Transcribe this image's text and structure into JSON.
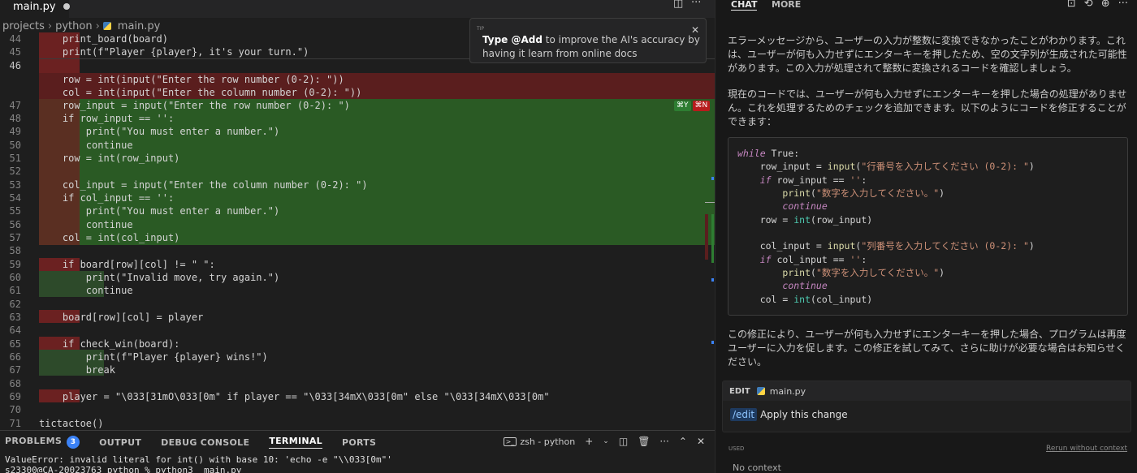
{
  "tabbar": {
    "active_tab": "main.py"
  },
  "breadcrumb": {
    "items": [
      "projects",
      "python",
      "main.py"
    ]
  },
  "editor": {
    "lines": [
      {
        "n": "44",
        "text": "    print_board(board)"
      },
      {
        "n": "45",
        "text": "    print(f\"Player {player}, it's your turn.\")"
      },
      {
        "n": "46",
        "text": ""
      },
      {
        "n": "",
        "text": "    row = int(input(\"Enter the row number (0-2): \"))"
      },
      {
        "n": "",
        "text": "    col = int(input(\"Enter the column number (0-2): \"))"
      },
      {
        "n": "47",
        "text": "    row_input = input(\"Enter the row number (0-2): \")"
      },
      {
        "n": "48",
        "text": "    if row_input == '':"
      },
      {
        "n": "49",
        "text": "        print(\"You must enter a number.\")"
      },
      {
        "n": "50",
        "text": "        continue"
      },
      {
        "n": "51",
        "text": "    row = int(row_input)"
      },
      {
        "n": "52",
        "text": ""
      },
      {
        "n": "53",
        "text": "    col_input = input(\"Enter the column number (0-2): \")"
      },
      {
        "n": "54",
        "text": "    if col_input == '':"
      },
      {
        "n": "55",
        "text": "        print(\"You must enter a number.\")"
      },
      {
        "n": "56",
        "text": "        continue"
      },
      {
        "n": "57",
        "text": "    col = int(col_input)"
      },
      {
        "n": "58",
        "text": ""
      },
      {
        "n": "59",
        "text": "    if board[row][col] != \" \":"
      },
      {
        "n": "60",
        "text": "        print(\"Invalid move, try again.\")"
      },
      {
        "n": "61",
        "text": "        continue"
      },
      {
        "n": "62",
        "text": ""
      },
      {
        "n": "63",
        "text": "    board[row][col] = player"
      },
      {
        "n": "64",
        "text": ""
      },
      {
        "n": "65",
        "text": "    if check_win(board):"
      },
      {
        "n": "66",
        "text": "        print(f\"Player {player} wins!\")"
      },
      {
        "n": "67",
        "text": "        break"
      },
      {
        "n": "68",
        "text": ""
      },
      {
        "n": "69",
        "text": "    player = \"\\033[31mO\\033[0m\" if player == \"\\033[34mX\\033[0m\" else \"\\033[34mX\\033[0m\""
      },
      {
        "n": "70",
        "text": ""
      },
      {
        "n": "71",
        "text": "tictactoe()"
      }
    ],
    "accept_hint": "⌘Y",
    "reject_hint": "⌘N"
  },
  "tip": {
    "label": "TIP",
    "bold": "Type @Add",
    "text": " to improve the AI's accuracy by having it learn from online docs"
  },
  "panel": {
    "tabs": [
      "PROBLEMS",
      "OUTPUT",
      "DEBUG CONSOLE",
      "TERMINAL",
      "PORTS"
    ],
    "problems_count": "3",
    "terminal_name": "zsh - python",
    "line1": "ValueError: invalid literal for int() with base 10: 'echo -e \"\\\\033[0m\"'",
    "line2": "s23300@CA-20023763 python % python3  main.py"
  },
  "sidebar": {
    "tabs": [
      "CHAT",
      "MORE"
    ],
    "para1": "エラーメッセージから、ユーザーの入力が整数に変換できなかったことがわかります。これは、ユーザーが何も入力せずにエンターキーを押したため、空の文字列が生成された可能性があります。この入力が処理されて整数に変換されるコードを確認しましょう。",
    "para2": "現在のコードでは、ユーザーが何も入力せずにエンターキーを押した場合の処理がありません。これを処理するためのチェックを追加できます。以下のようにコードを修正することができます：",
    "code": {
      "l1_kw": "while",
      "l1_rest": " True:",
      "l2": "行番号を入力してください (0-2): ",
      "l6": "数字を入力してください。",
      "l10": "列番号を入力してください (0-2): "
    },
    "para3": "この修正により、ユーザーが何も入力せずにエンターキーを押した場合、プログラムは再度ユーザーに入力を促します。この修正を試してみて、さらに助けが必要な場合はお知らせください。",
    "edit_label": "EDIT",
    "edit_file": "main.py",
    "edit_command": "/edit",
    "edit_text": "Apply this change",
    "used_label": "USED",
    "rerun_label": "Rerun without context",
    "no_context": "No context"
  }
}
